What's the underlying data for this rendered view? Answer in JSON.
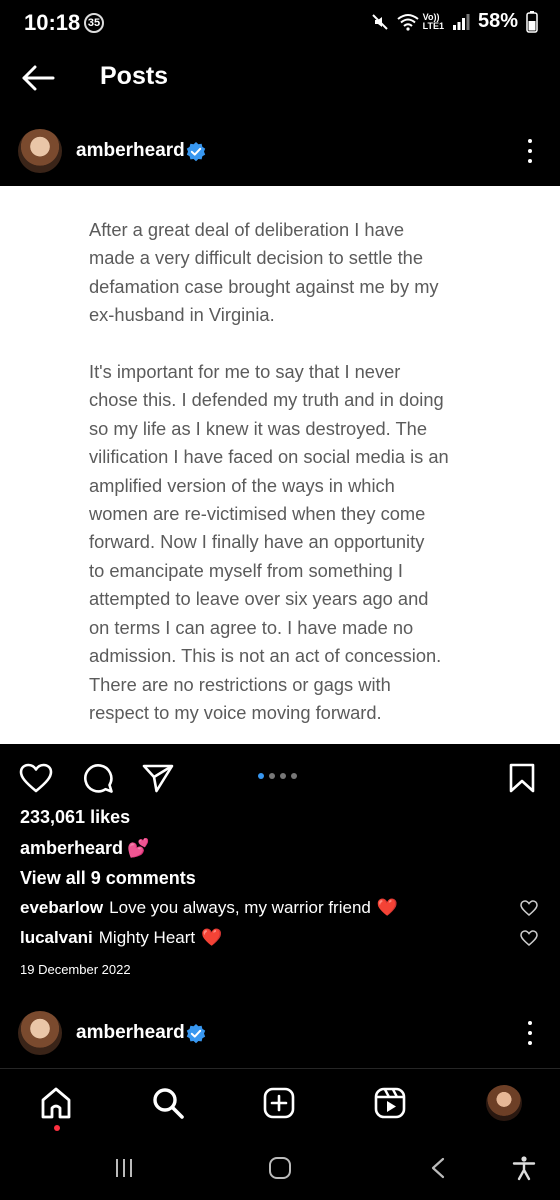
{
  "status_bar": {
    "time": "10:18",
    "notification_count": "35",
    "network_label_top": "Vo))",
    "network_label_bottom": "LTE1",
    "wifi_label": "6",
    "battery": "58%"
  },
  "header": {
    "title": "Posts",
    "back_icon": "arrow-left-icon"
  },
  "post": {
    "username": "amberheard",
    "verified": true,
    "image_text": "After a great deal of deliberation I have\nmade a very difficult decision to settle the\ndefamation case brought against me by my\nex-husband in Virginia.\n\nIt's important for me to say that I never\nchose this. I defended my truth and in doing\nso my life as I knew it was destroyed. The\nvilification I have faced on social media is an\namplified version of the ways in which\nwomen are re-victimised when they come\nforward.  Now I finally have an opportunity\nto emancipate myself from something I\nattempted to leave over six years ago and\non terms I can agree to. I have made no\nadmission. This is not an act of concession.\nThere are no restrictions or gags with\nrespect to my voice moving forward.",
    "carousel_total": 4,
    "carousel_active": 1,
    "likes": "233,061 likes",
    "caption_user": "amberheard",
    "caption_emoji": "💕",
    "view_comments": "View all 9 comments",
    "comments": [
      {
        "user": "evebarlow",
        "text": "Love you always, my warrior friend",
        "emoji": "❤️"
      },
      {
        "user": "lucalvani",
        "text": "Mighty Heart",
        "emoji": "❤️"
      }
    ],
    "date": "19 December 2022"
  },
  "next_post": {
    "username": "amberheard"
  },
  "bottom_nav": {
    "items": [
      "home-icon",
      "search-icon",
      "create-icon",
      "reels-icon",
      "profile-avatar"
    ]
  },
  "colors": {
    "background": "#000000",
    "verified_blue": "#3897f0",
    "heart_red": "#ed4956",
    "notification_red": "#ff3040",
    "post_text": "#5b5b5b"
  }
}
